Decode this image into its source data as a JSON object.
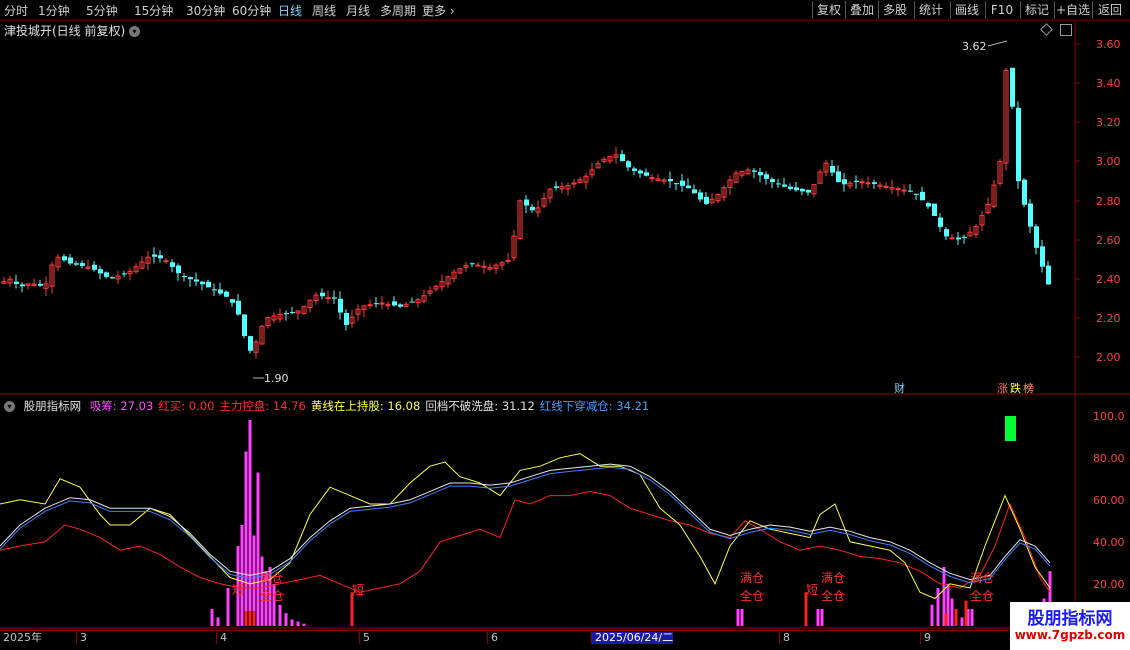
{
  "toolbar": {
    "periods": [
      "分时",
      "1分钟",
      "5分钟",
      "15分钟",
      "30分钟",
      "60分钟",
      "日线",
      "周线",
      "月线",
      "多周期",
      "更多"
    ],
    "active_period": "日线",
    "right_buttons": [
      "复权",
      "叠加",
      "多股",
      "统计",
      "画线",
      "F10",
      "标记",
      "+自选",
      "返回"
    ]
  },
  "stock": {
    "title": "津投城开(日线 前复权)",
    "price_axis": [
      "3.60",
      "3.40",
      "3.20",
      "3.00",
      "2.80",
      "2.60",
      "2.40",
      "2.20",
      "2.00"
    ],
    "high_label": "3.62",
    "low_label": "1.90",
    "badge_cai": "财",
    "badge_zhang": "涨",
    "badge_die": "跌",
    "badge_bang": "榜"
  },
  "indicator": {
    "name": "股朋指标网",
    "items": [
      {
        "label": "吸筹: ",
        "value": "27.03",
        "color": "#ff4fff"
      },
      {
        "label": "红买: ",
        "value": "0.00",
        "color": "#ff3030"
      },
      {
        "label": "主力控盘: ",
        "value": "14.76",
        "color": "#ff3030"
      },
      {
        "label": "黄线在上持股: ",
        "value": "16.08",
        "color": "#ffff40"
      },
      {
        "label": "回档不破洗盘: ",
        "value": "31.12",
        "color": "#e0e0e0"
      },
      {
        "label": "红线下穿减仓: ",
        "value": "34.21",
        "color": "#40a0ff"
      }
    ],
    "axis": [
      "100.0",
      "80.00",
      "60.00",
      "40.00",
      "20.00"
    ],
    "annotations": [
      "短",
      "减仓",
      "全仓",
      "短",
      "满仓",
      "全仓",
      "短",
      "满仓",
      "全仓",
      "满仓",
      "全仓"
    ]
  },
  "dates": {
    "labels": [
      "2025年",
      "3",
      "4",
      "5",
      "6",
      "2025/06/24/二",
      "8",
      "9"
    ]
  },
  "watermark": {
    "line1": "股朋指标网",
    "line2": "www.7gpzb.com"
  },
  "colors": {
    "up": "#ff3b3b",
    "down": "#54ffff",
    "grid": "#8b0000",
    "rise_candle": "red-hollow",
    "fall_candle": "cyan-solid"
  }
}
